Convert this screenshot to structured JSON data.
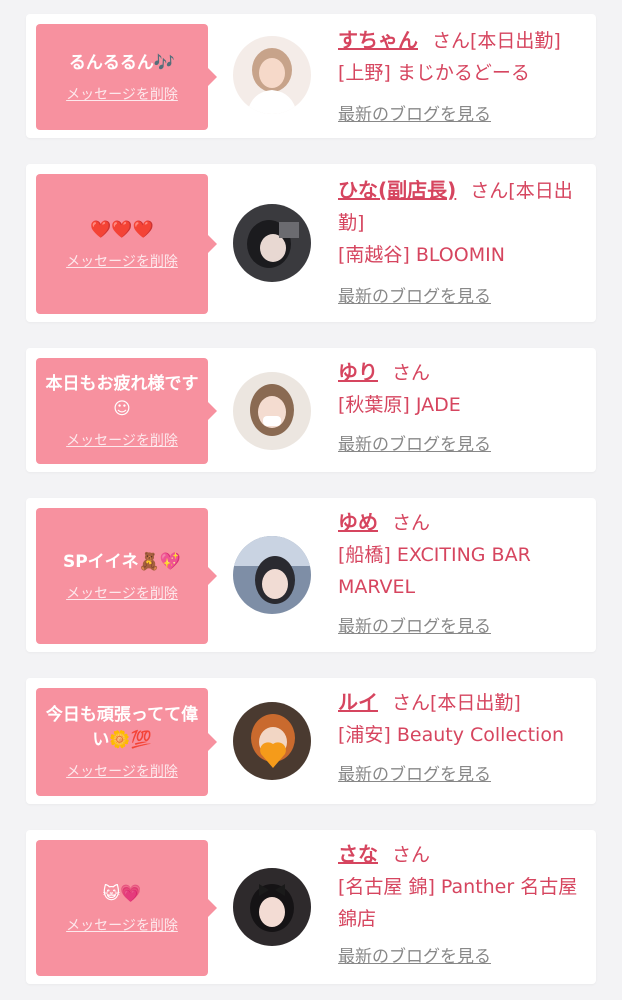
{
  "items": [
    {
      "message": "るんるるん🎶",
      "delete_label": "メッセージを削除",
      "name": "すちゃん",
      "honorific": "さん",
      "attendance": "[本日出勤]",
      "shop": "[上野] まじかるどーる",
      "blog_label": "最新のブログを見る",
      "avatar_icon": "girl-photo-light-hair"
    },
    {
      "message": "❤️❤️❤️",
      "delete_label": "メッセージを削除",
      "name": "ひな(副店長)",
      "honorific": "さん",
      "attendance": "[本日出勤]",
      "shop": "[南越谷] BLOOMIN",
      "blog_label": "最新のブログを見る",
      "avatar_icon": "girl-photo-dark-hair"
    },
    {
      "message": "本日もお疲れ様です☺︎",
      "delete_label": "メッセージを削除",
      "name": "ゆり",
      "honorific": "さん",
      "attendance": "",
      "shop": "[秋葉原] JADE",
      "blog_label": "最新のブログを見る",
      "avatar_icon": "girl-photo-mask"
    },
    {
      "message": "SPイイネ🧸💖",
      "delete_label": "メッセージを削除",
      "name": "ゆめ",
      "honorific": "さん",
      "attendance": "",
      "shop": "[船橋] EXCITING BAR MARVEL",
      "blog_label": "最新のブログを見る",
      "avatar_icon": "girl-photo-car"
    },
    {
      "message": "今日も頑張ってて偉い🌼💯",
      "delete_label": "メッセージを削除",
      "name": "ルイ",
      "honorific": "さん",
      "attendance": "[本日出勤]",
      "shop": "[浦安] Beauty Collection",
      "blog_label": "最新のブログを見る",
      "avatar_icon": "girl-photo-heart"
    },
    {
      "message": "😺💗",
      "delete_label": "メッセージを削除",
      "name": "さな",
      "honorific": "さん",
      "attendance": "",
      "shop": "[名古屋 錦] Panther 名古屋錦店",
      "blog_label": "最新のブログを見る",
      "avatar_icon": "girl-photo-bow"
    }
  ],
  "colors": {
    "accent": "#d6455f",
    "bubble": "#f7919f",
    "background": "#f3f3f5"
  }
}
